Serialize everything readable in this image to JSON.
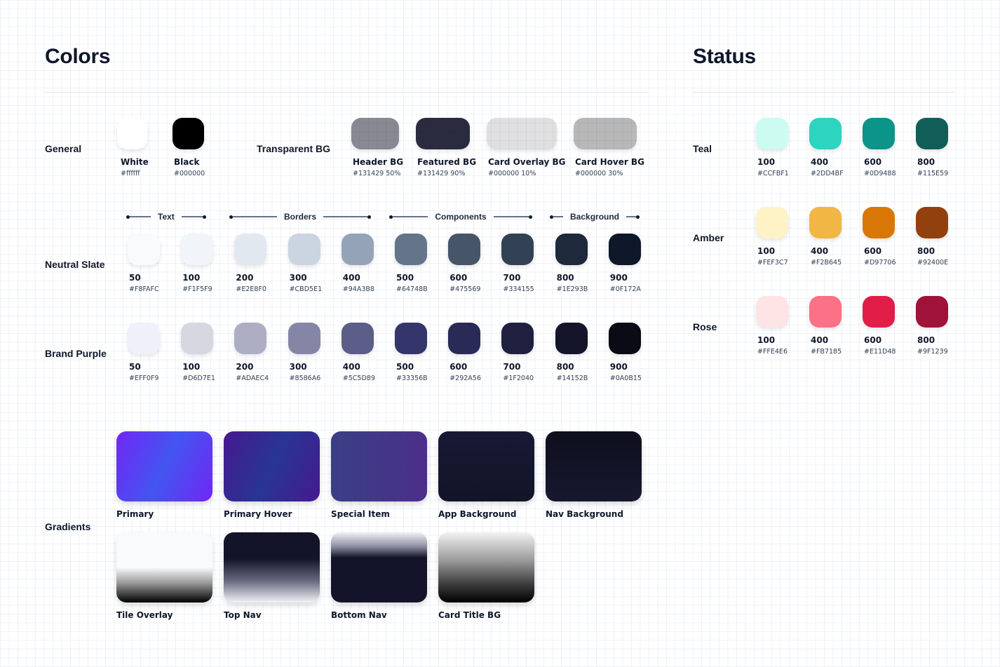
{
  "colors_section": {
    "title": "Colors",
    "general": {
      "label": "General",
      "swatches": [
        {
          "name": "White",
          "hex": "#ffffff",
          "color": "#ffffff"
        },
        {
          "name": "Black",
          "hex": "#000000",
          "color": "#000000"
        }
      ]
    },
    "transparent_bg": {
      "label": "Transparent BG",
      "swatches": [
        {
          "name": "Header BG",
          "hex": "#131429 50%",
          "color": "rgba(19,20,41,0.5)"
        },
        {
          "name": "Featured BG",
          "hex": "#131429 90%",
          "color": "rgba(19,20,41,0.9)"
        },
        {
          "name": "Card Overlay BG",
          "hex": "#000000 10%",
          "color": "rgba(0,0,0,0.12)"
        },
        {
          "name": "Card Hover BG",
          "hex": "#000000 30%",
          "color": "rgba(0,0,0,0.28)"
        }
      ]
    },
    "neutral_slate": {
      "label": "Neutral Slate",
      "groups": [
        "Text",
        "Borders",
        "Components",
        "Background"
      ],
      "swatches": [
        {
          "name": "50",
          "hex": "#F8FAFC",
          "color": "#F8FAFC"
        },
        {
          "name": "100",
          "hex": "#F1F5F9",
          "color": "#F1F5F9"
        },
        {
          "name": "200",
          "hex": "#E2E8F0",
          "color": "#E2E8F0"
        },
        {
          "name": "300",
          "hex": "#CBD5E1",
          "color": "#CBD5E1"
        },
        {
          "name": "400",
          "hex": "#94A3B8",
          "color": "#94A3B8"
        },
        {
          "name": "500",
          "hex": "#64748B",
          "color": "#64748B"
        },
        {
          "name": "600",
          "hex": "#475569",
          "color": "#475569"
        },
        {
          "name": "700",
          "hex": "#334155",
          "color": "#334155"
        },
        {
          "name": "800",
          "hex": "#1E293B",
          "color": "#1E293B"
        },
        {
          "name": "900",
          "hex": "#0F172A",
          "color": "#0F172A"
        }
      ]
    },
    "brand_purple": {
      "label": "Brand Purple",
      "swatches": [
        {
          "name": "50",
          "hex": "#EFF0F9",
          "color": "#EFF0F9"
        },
        {
          "name": "100",
          "hex": "#D6D7E1",
          "color": "#D6D7E1"
        },
        {
          "name": "200",
          "hex": "#ADAEC4",
          "color": "#ADAEC4"
        },
        {
          "name": "300",
          "hex": "#8586A6",
          "color": "#8586A6"
        },
        {
          "name": "400",
          "hex": "#5C5D89",
          "color": "#5C5D89"
        },
        {
          "name": "500",
          "hex": "#33356B",
          "color": "#33356B"
        },
        {
          "name": "600",
          "hex": "#292A56",
          "color": "#292A56"
        },
        {
          "name": "700",
          "hex": "#1F2040",
          "color": "#1F2040"
        },
        {
          "name": "800",
          "hex": "#14152B",
          "color": "#14152B"
        },
        {
          "name": "900",
          "hex": "#0A0B15",
          "color": "#0A0B15"
        }
      ]
    },
    "gradients": {
      "label": "Gradients",
      "items": [
        {
          "name": "Primary",
          "css": "linear-gradient(115deg, #7127f4 0%, #4355f0 50%, #7127f4 100%)"
        },
        {
          "name": "Primary Hover",
          "css": "linear-gradient(115deg, #46198f 0%, #283593 50%, #46198f 100%)"
        },
        {
          "name": "Special Item",
          "css": "linear-gradient(90deg, #3a3f85 0%, #4b2f8a 100%)"
        },
        {
          "name": "App Background",
          "css": "linear-gradient(180deg, #171936 0%, #121427 100%)"
        },
        {
          "name": "Nav Background",
          "css": "linear-gradient(180deg, #0e0f1d 0%, #16182f 100%)"
        },
        {
          "name": "Tile Overlay",
          "css": "linear-gradient(180deg, #f8fafc 0%, #f8fafc 50%, #9a9a9a 72%, #000000 100%)"
        },
        {
          "name": "Top Nav",
          "css": "linear-gradient(180deg, #131429 0%, #131429 38%, #6b6c82 70%, #f1f2f6 100%)"
        },
        {
          "name": "Bottom Nav",
          "css": "linear-gradient(180deg, #f0f1f5 0%, #8e8fa3 20%, #131429 36%, #131429 100%)"
        },
        {
          "name": "Card Title BG",
          "css": "linear-gradient(180deg, #f2f2f2 0%, #9a9a9a 40%, #3a3a3a 75%, #000000 100%)"
        }
      ]
    }
  },
  "status_section": {
    "title": "Status",
    "teal": {
      "label": "Teal",
      "swatches": [
        {
          "name": "100",
          "hex": "#CCFBF1",
          "color": "#CCFBF1"
        },
        {
          "name": "400",
          "hex": "#2DD4BF",
          "color": "#2DD4BF"
        },
        {
          "name": "600",
          "hex": "#0D9488",
          "color": "#0D9488"
        },
        {
          "name": "800",
          "hex": "#115E59",
          "color": "#115E59"
        }
      ]
    },
    "amber": {
      "label": "Amber",
      "swatches": [
        {
          "name": "100",
          "hex": "#FEF3C7",
          "color": "#FEF3C7"
        },
        {
          "name": "400",
          "hex": "#F2B645",
          "color": "#F2B645"
        },
        {
          "name": "600",
          "hex": "#D97706",
          "color": "#D97706"
        },
        {
          "name": "800",
          "hex": "#92400E",
          "color": "#92400E"
        }
      ]
    },
    "rose": {
      "label": "Rose",
      "swatches": [
        {
          "name": "100",
          "hex": "#FFE4E6",
          "color": "#FFE4E6"
        },
        {
          "name": "400",
          "hex": "#FB7185",
          "color": "#FB7185"
        },
        {
          "name": "600",
          "hex": "#E11D48",
          "color": "#E11D48"
        },
        {
          "name": "800",
          "hex": "#9F1239",
          "color": "#9F1239"
        }
      ]
    }
  }
}
